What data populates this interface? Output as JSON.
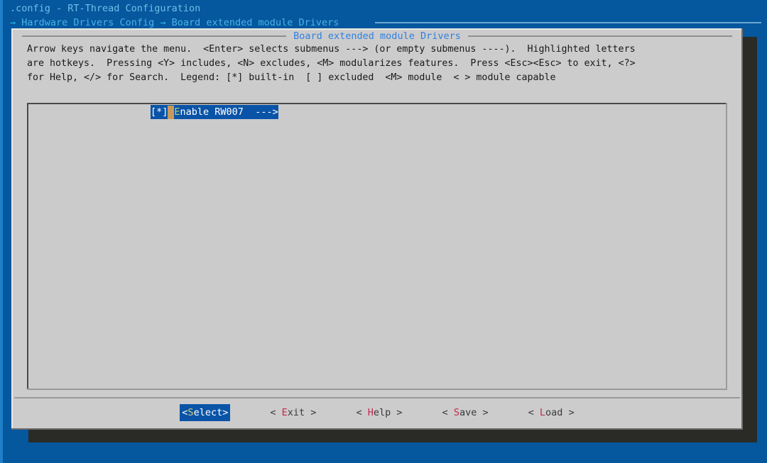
{
  "window": {
    "title": ".config - RT-Thread Configuration",
    "breadcrumb": {
      "arrow": "→",
      "items": [
        "Hardware Drivers Config",
        "Board extended module Drivers"
      ],
      "full_text": "→ Hardware Drivers Config → Board extended module Drivers"
    }
  },
  "dialog": {
    "title": "Board extended module Drivers",
    "help_lines": [
      "Arrow keys navigate the menu.  <Enter> selects submenus ---> (or empty submenus ----).  Highlighted letters",
      "are hotkeys.  Pressing <Y> includes, <N> excludes, <M> modularizes features.  Press <Esc><Esc> to exit, <?>",
      "for Help, </> for Search.  Legend: [*] built-in  [ ] excluded  <M> module  < > module capable"
    ]
  },
  "menu": {
    "items": [
      {
        "tag": "[*]",
        "hotkey": "E",
        "label": "nable RW007",
        "submenu_arrow": "--->",
        "spacer": "  ",
        "selected": true
      }
    ]
  },
  "buttons": [
    {
      "left": "<",
      "hotkey": "S",
      "rest": "elect",
      "right": ">",
      "pre": "",
      "post": "",
      "selected": true
    },
    {
      "left": "<",
      "hotkey": "E",
      "rest": "xit",
      "right": ">",
      "pre": " ",
      "post": " ",
      "selected": false
    },
    {
      "left": "<",
      "hotkey": "H",
      "rest": "elp",
      "right": ">",
      "pre": " ",
      "post": " ",
      "selected": false
    },
    {
      "left": "<",
      "hotkey": "S",
      "rest": "ave",
      "right": ">",
      "pre": " ",
      "post": " ",
      "selected": false
    },
    {
      "left": "<",
      "hotkey": "L",
      "rest": "oad",
      "right": ">",
      "pre": " ",
      "post": " ",
      "selected": false
    }
  ],
  "colors": {
    "desktop_blue": "#05579e",
    "dialog_gray": "#cccccc",
    "listbox_gray": "#cbcbcb",
    "selection_blue": "#0a54a8",
    "cursor_tan": "#c79a5c",
    "title_blue": "#2f7fe0",
    "breadcrumb_cyan": "#49b4e8",
    "hotkey_red": "#c42a4f",
    "hotkey_yellow": "#d4cf63",
    "shadow_dark": "#2a2b26"
  }
}
